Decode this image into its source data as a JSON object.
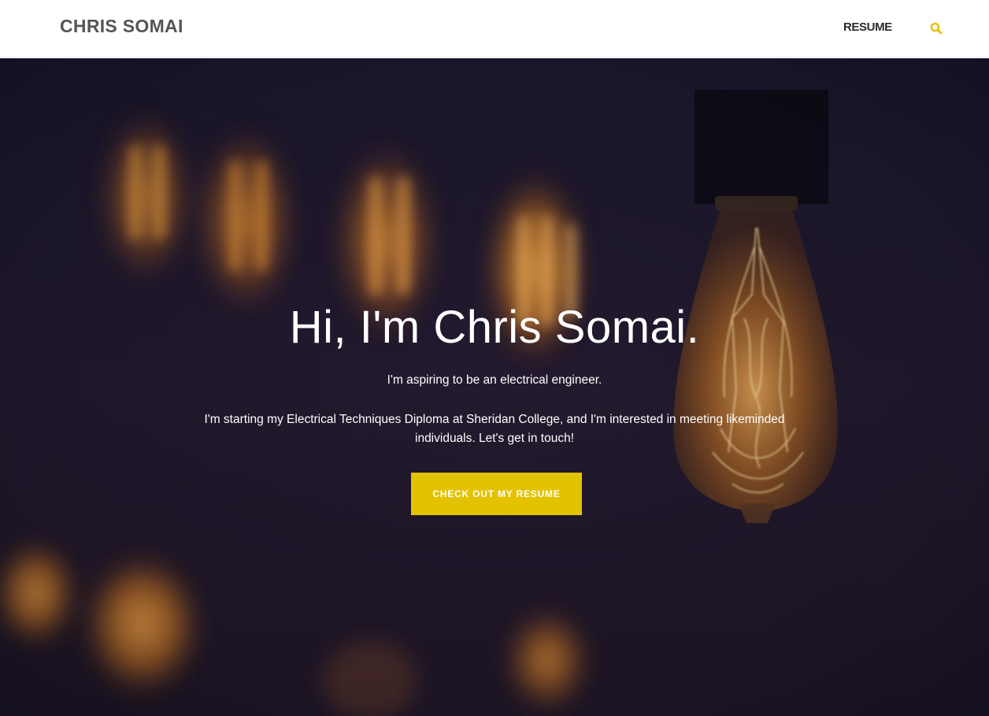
{
  "header": {
    "site_title": "CHRIS SOMAI",
    "nav_resume": "RESUME",
    "search_icon": "search-icon",
    "accent_color": "#e3c200"
  },
  "hero": {
    "heading": "Hi, I'm Chris Somai.",
    "subheading": "I'm aspiring to be an electrical engineer.",
    "description": "I'm starting my Electrical Techniques Diploma at Sheridan College, and I'm interested in meeting likeminded individuals. Let's get in touch!",
    "cta_label": "CHECK OUT MY RESUME"
  }
}
